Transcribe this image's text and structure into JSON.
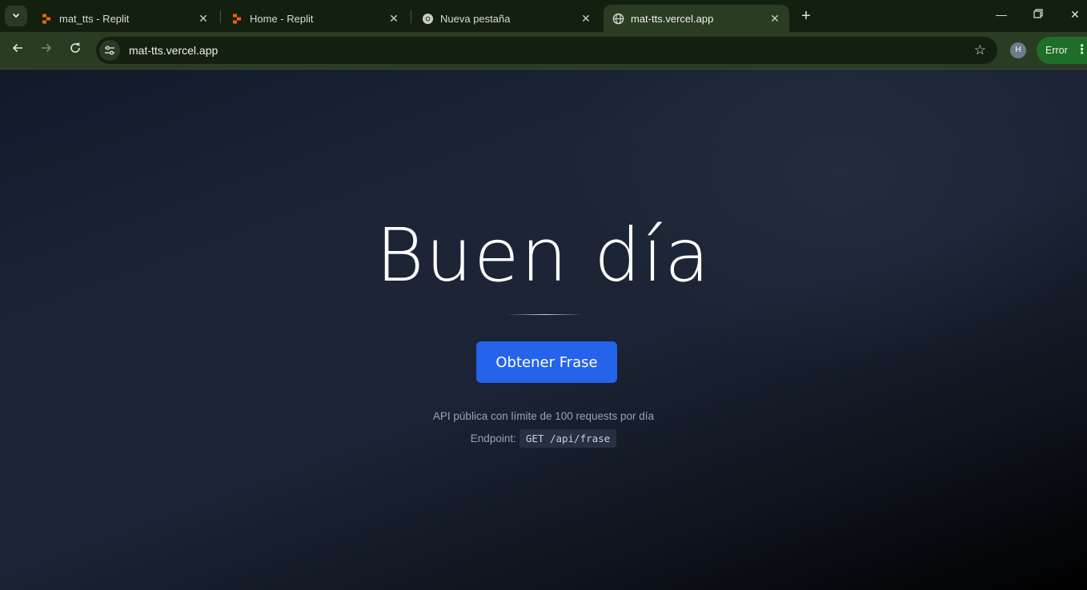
{
  "browser": {
    "tabs": [
      {
        "title": "mat_tts - Replit",
        "favicon": "replit-icon",
        "active": false
      },
      {
        "title": "Home - Replit",
        "favicon": "replit-icon",
        "active": false
      },
      {
        "title": "Nueva pestaña",
        "favicon": "chrome-icon",
        "active": false
      },
      {
        "title": "mat-tts.vercel.app",
        "favicon": "globe-icon",
        "active": true
      }
    ],
    "url": "mat-tts.vercel.app",
    "profile_initial": "H",
    "error_label": "Error",
    "colors": {
      "frame": "#14200f",
      "toolbar": "#2a3c22",
      "error_pill": "#1e6e2a",
      "replit_orange": "#f26207"
    }
  },
  "page": {
    "greeting": "Buen día",
    "button_label": "Obtener Frase",
    "note": "API pública con límite de 100 requests por día",
    "endpoint_label": "Endpoint:",
    "endpoint_code": "GET /api/frase",
    "colors": {
      "button": "#2563eb",
      "background": "#1c2536",
      "text_muted": "#9aa3b2"
    }
  }
}
